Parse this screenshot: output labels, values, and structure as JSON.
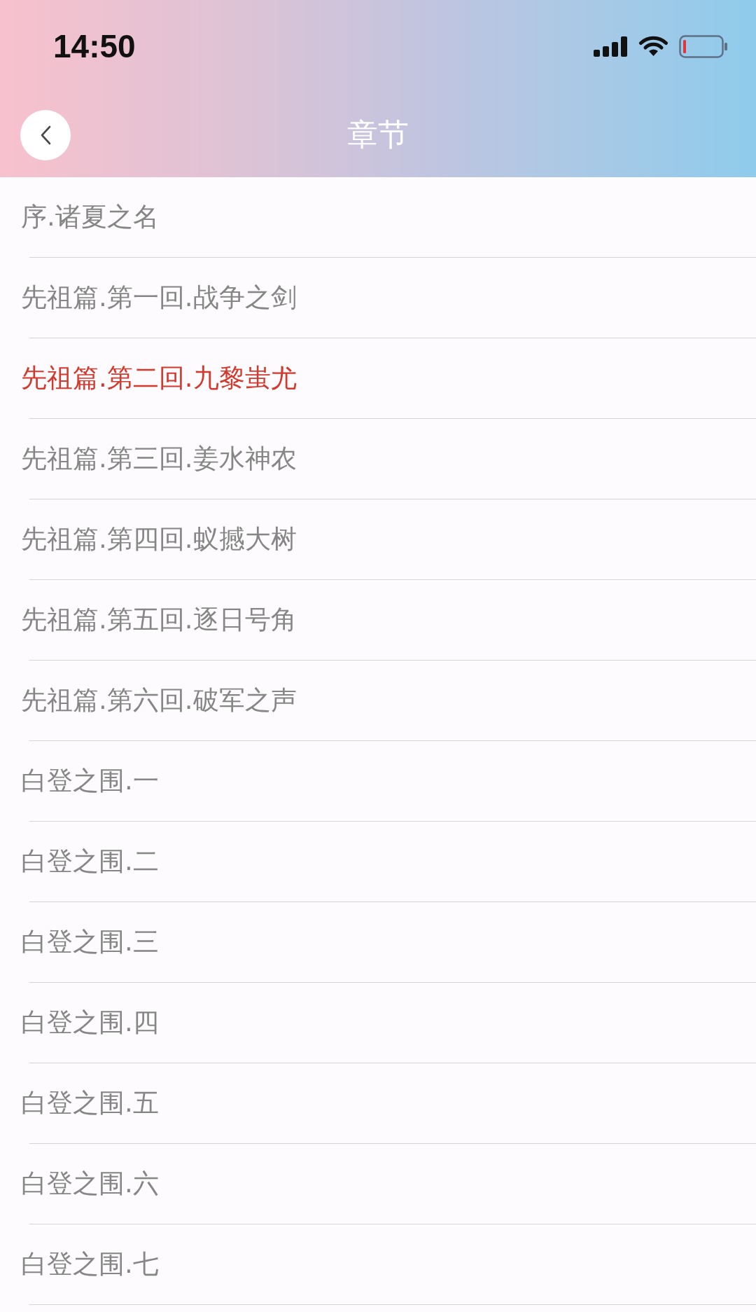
{
  "status_bar": {
    "time": "14:50"
  },
  "nav_bar": {
    "title": "章节"
  },
  "chapters": [
    {
      "title": "序.诸夏之名",
      "selected": false
    },
    {
      "title": "先祖篇.第一回.战争之剑",
      "selected": false
    },
    {
      "title": "先祖篇.第二回.九黎蚩尤",
      "selected": true
    },
    {
      "title": "先祖篇.第三回.姜水神农",
      "selected": false
    },
    {
      "title": "先祖篇.第四回.蚁撼大树",
      "selected": false
    },
    {
      "title": "先祖篇.第五回.逐日号角",
      "selected": false
    },
    {
      "title": "先祖篇.第六回.破军之声",
      "selected": false
    },
    {
      "title": "白登之围.一",
      "selected": false
    },
    {
      "title": "白登之围.二",
      "selected": false
    },
    {
      "title": "白登之围.三",
      "selected": false
    },
    {
      "title": "白登之围.四",
      "selected": false
    },
    {
      "title": "白登之围.五",
      "selected": false
    },
    {
      "title": "白登之围.六",
      "selected": false
    },
    {
      "title": "白登之围.七",
      "selected": false
    }
  ]
}
